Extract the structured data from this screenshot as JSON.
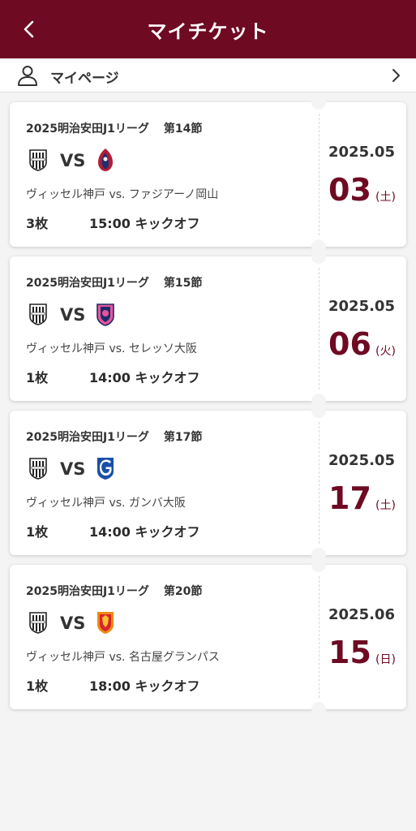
{
  "header": {
    "title": "マイチケット",
    "back_icon": "chevron-left-icon"
  },
  "mypage": {
    "label": "マイページ",
    "icon": "user-icon",
    "chevron": "chevron-right-icon"
  },
  "colors": {
    "brand": "#6e0a22",
    "background": "#f4f4f4"
  },
  "tickets": [
    {
      "league": "2025明治安田J1リーグ",
      "round": "第14節",
      "vs": "VS",
      "matchup": "ヴィッセル神戸 vs. ファジアーノ岡山",
      "count": "3枚",
      "kickoff": "15:00 キックオフ",
      "year_month": "2025.05",
      "day": "03",
      "weekday": "(土)",
      "home_emblem": "vissel-kobe-emblem",
      "away_emblem": "fagiano-okayama-emblem"
    },
    {
      "league": "2025明治安田J1リーグ",
      "round": "第15節",
      "vs": "VS",
      "matchup": "ヴィッセル神戸 vs. セレッソ大阪",
      "count": "1枚",
      "kickoff": "14:00 キックオフ",
      "year_month": "2025.05",
      "day": "06",
      "weekday": "(火)",
      "home_emblem": "vissel-kobe-emblem",
      "away_emblem": "cerezo-osaka-emblem"
    },
    {
      "league": "2025明治安田J1リーグ",
      "round": "第17節",
      "vs": "VS",
      "matchup": "ヴィッセル神戸 vs. ガンバ大阪",
      "count": "1枚",
      "kickoff": "14:00 キックオフ",
      "year_month": "2025.05",
      "day": "17",
      "weekday": "(土)",
      "home_emblem": "vissel-kobe-emblem",
      "away_emblem": "gamba-osaka-emblem"
    },
    {
      "league": "2025明治安田J1リーグ",
      "round": "第20節",
      "vs": "VS",
      "matchup": "ヴィッセル神戸 vs. 名古屋グランパス",
      "count": "1枚",
      "kickoff": "18:00 キックオフ",
      "year_month": "2025.06",
      "day": "15",
      "weekday": "(日)",
      "home_emblem": "vissel-kobe-emblem",
      "away_emblem": "nagoya-grampus-emblem"
    }
  ]
}
